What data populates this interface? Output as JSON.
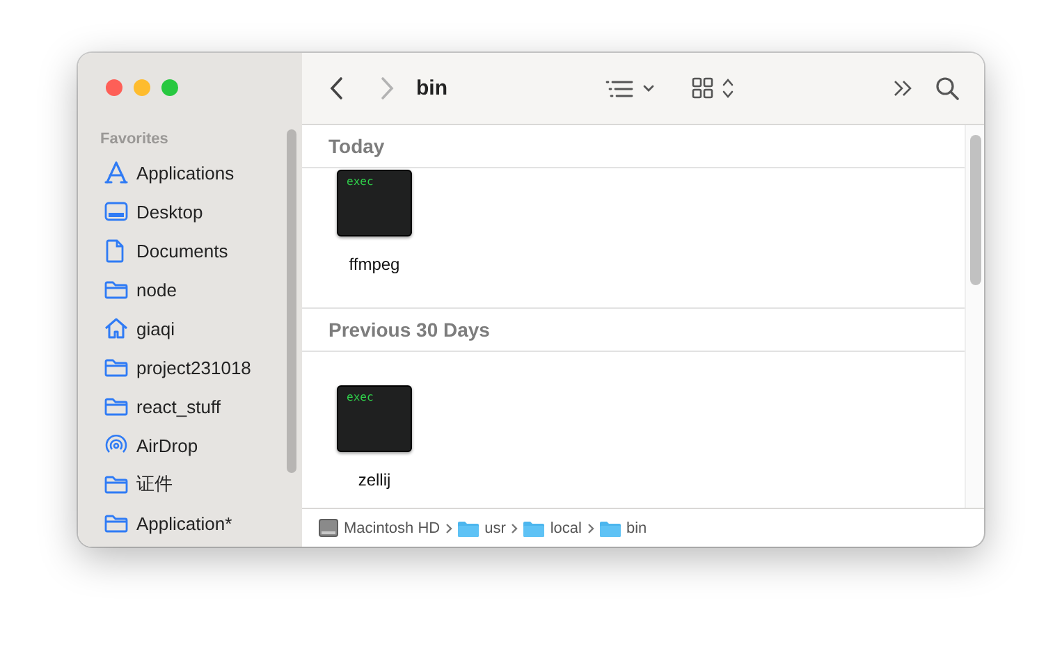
{
  "window": {
    "title": "bin"
  },
  "sidebar": {
    "heading": "Favorites",
    "items": [
      {
        "label": "Applications",
        "kind": "apps"
      },
      {
        "label": "Desktop",
        "kind": "desktop"
      },
      {
        "label": "Documents",
        "kind": "document"
      },
      {
        "label": "node",
        "kind": "folder"
      },
      {
        "label": "giaqi",
        "kind": "home"
      },
      {
        "label": "project231018",
        "kind": "folder"
      },
      {
        "label": "react_stuff",
        "kind": "folder"
      },
      {
        "label": "AirDrop",
        "kind": "airdrop"
      },
      {
        "label": "证件",
        "kind": "folder"
      },
      {
        "label": "Application*",
        "kind": "folder"
      }
    ]
  },
  "sections": [
    {
      "title": "Today",
      "files": [
        {
          "name": "ffmpeg",
          "badge": "exec"
        }
      ]
    },
    {
      "title": "Previous 30 Days",
      "files": [
        {
          "name": "zellij",
          "badge": "exec"
        }
      ]
    }
  ],
  "path_bar": [
    {
      "label": "Macintosh HD",
      "kind": "disk"
    },
    {
      "label": "usr",
      "kind": "folder"
    },
    {
      "label": "local",
      "kind": "folder"
    },
    {
      "label": "bin",
      "kind": "folder"
    }
  ]
}
